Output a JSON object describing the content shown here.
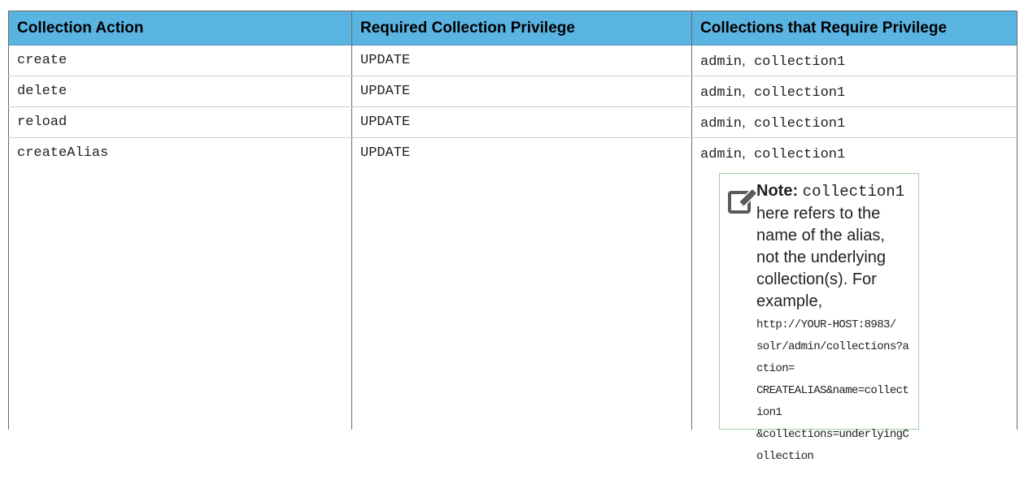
{
  "table": {
    "headers": [
      "Collection Action",
      "Required Collection Privilege",
      "Collections that Require Privilege"
    ],
    "rows": [
      {
        "action": "create",
        "privilege": "UPDATE",
        "collections": [
          "admin",
          "collection1"
        ]
      },
      {
        "action": "delete",
        "privilege": "UPDATE",
        "collections": [
          "admin",
          "collection1"
        ]
      },
      {
        "action": "reload",
        "privilege": "UPDATE",
        "collections": [
          "admin",
          "collection1"
        ]
      },
      {
        "action": "createAlias",
        "privilege": "UPDATE",
        "collections": [
          "admin",
          "collection1"
        ]
      }
    ],
    "separator": ","
  },
  "note": {
    "icon": "pencil-note-icon",
    "label": "Note:",
    "code": "collection1",
    "text": "here refers to the name of the alias, not the underlying collection(s). For example,",
    "url_lines": [
      "http://YOUR-HOST:8983/",
      "solr/admin/collections?action=",
      "CREATEALIAS&name=collection1",
      "&collections=underlyingCollection"
    ]
  }
}
